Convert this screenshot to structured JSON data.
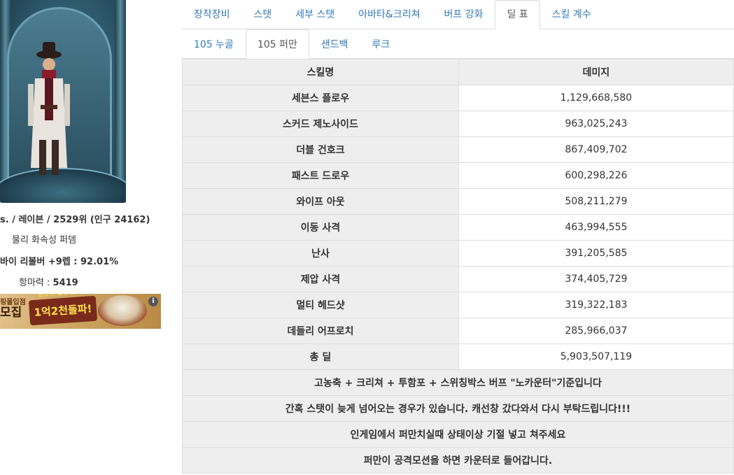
{
  "character": {
    "info_line1": "s. / 레이븐 / 2529위 (인구 24162)",
    "info_line2": "물리 화속성 퍼뎀",
    "info_line3": "바이 리볼버 +9렙 : 92.01%",
    "info_line4_label": "항마력 : ",
    "info_line4_value": "5419"
  },
  "ad": {
    "left_small": "핑몰입점",
    "left_big": "모집",
    "badge_top": "군산 ○ 몰링 월매출",
    "badge_main": "1억2천돌파!",
    "info_glyph": "i"
  },
  "top_tabs": [
    {
      "label": "장착장비",
      "active": false
    },
    {
      "label": "스탯",
      "active": false
    },
    {
      "label": "세부 스탯",
      "active": false
    },
    {
      "label": "아바타&크리쳐",
      "active": false
    },
    {
      "label": "버프 강화",
      "active": false
    },
    {
      "label": "딜 표",
      "active": true
    },
    {
      "label": "스킬 계수",
      "active": false
    }
  ],
  "sub_tabs": [
    {
      "label": "105 누골",
      "active": false
    },
    {
      "label": "105 퍼만",
      "active": true
    },
    {
      "label": "샌드백",
      "active": false
    },
    {
      "label": "루크",
      "active": false
    }
  ],
  "table": {
    "headers": [
      "스킬명",
      "데미지"
    ],
    "rows": [
      {
        "skill": "세븐스 플로우",
        "damage": "1,129,668,580"
      },
      {
        "skill": "스커드 제노사이드",
        "damage": "963,025,243"
      },
      {
        "skill": "더블 건호크",
        "damage": "867,409,702"
      },
      {
        "skill": "패스트 드로우",
        "damage": "600,298,226"
      },
      {
        "skill": "와이프 아웃",
        "damage": "508,211,279"
      },
      {
        "skill": "이동 사격",
        "damage": "463,994,555"
      },
      {
        "skill": "난사",
        "damage": "391,205,585"
      },
      {
        "skill": "제압 사격",
        "damage": "374,405,729"
      },
      {
        "skill": "멀티 헤드샷",
        "damage": "319,322,183"
      },
      {
        "skill": "데들리 어프로치",
        "damage": "285,966,037"
      },
      {
        "skill": "총 딜",
        "damage": "5,903,507,119"
      }
    ],
    "notes": [
      "고농축 + 크리쳐 + 투함포 + 스위칭박스 버프 \"노카운터\"기준입니다",
      "간혹 스탯이 늦게 넘어오는 경우가 있습니다. 캐선창 갔다와서 다시 부탁드립니다!!!",
      "인게임에서 퍼만치실때 상태이상 기절 넣고 쳐주세요",
      "퍼만이 공격모션을 하면 카운터로 들어갑니다."
    ]
  }
}
